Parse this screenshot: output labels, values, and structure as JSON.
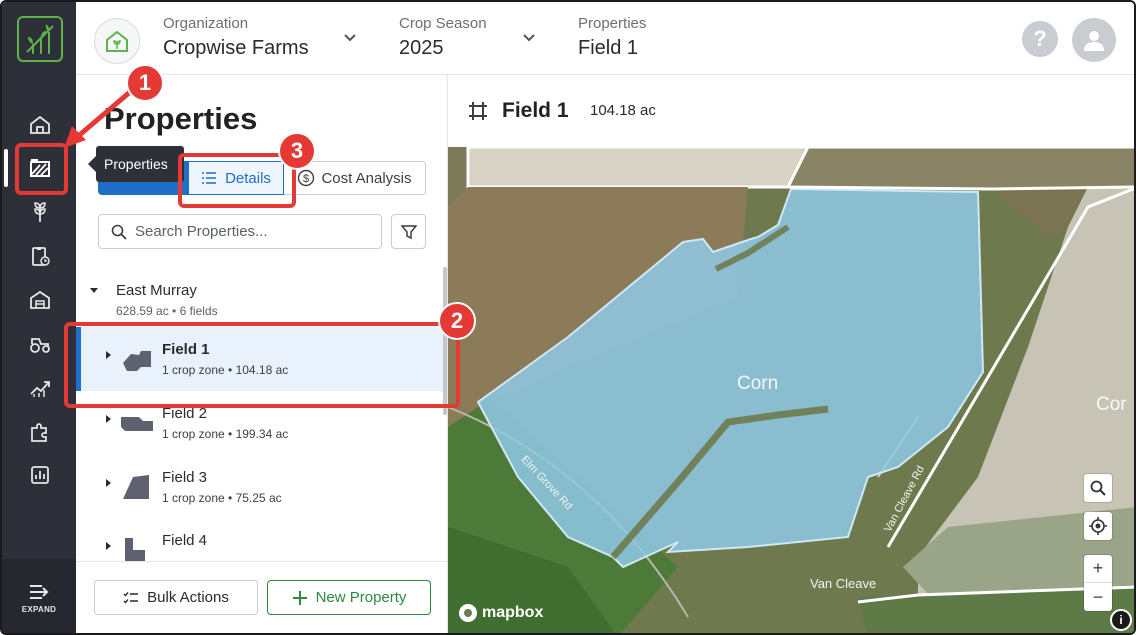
{
  "topbar": {
    "organization": {
      "label": "Organization",
      "value": "Cropwise Farms"
    },
    "crop_season": {
      "label": "Crop Season",
      "value": "2025"
    },
    "properties": {
      "label": "Properties",
      "value": "Field 1"
    },
    "help_label": "?"
  },
  "nav": {
    "items": [
      "home-icon",
      "properties-icon",
      "crop-icon",
      "plan-icon",
      "storage-icon",
      "equipment-icon",
      "analytics-growth-icon",
      "integrations-icon",
      "reports-icon"
    ],
    "expand_label": "EXPAND",
    "tooltip": "Properties"
  },
  "panel": {
    "title": "Properties",
    "tabs": {
      "details": "Details",
      "cost_analysis": "Cost Analysis"
    },
    "search_placeholder": "Search Properties...",
    "group": {
      "name": "East Murray",
      "meta": "628.59 ac • 6 fields"
    },
    "fields": [
      {
        "name": "Field 1",
        "meta": "1 crop zone • 104.18 ac"
      },
      {
        "name": "Field 2",
        "meta": "1 crop zone • 199.34 ac"
      },
      {
        "name": "Field 3",
        "meta": "1 crop zone • 75.25 ac"
      },
      {
        "name": "Field 4",
        "meta": ""
      }
    ],
    "footer": {
      "bulk_actions": "Bulk Actions",
      "new_property": "New Property"
    }
  },
  "map": {
    "title": "Field 1",
    "area": "104.18 ac",
    "crop_label": "Corn",
    "neighbor_label": "Cor",
    "road_labels": [
      "Elm Grove Rd",
      "Van Cleave Rd",
      "Van Cleave"
    ],
    "attribution": "mapbox",
    "info_label": "i",
    "zoom_in": "+",
    "zoom_out": "−"
  },
  "annotations": {
    "badge1": "1",
    "badge2": "2",
    "badge3": "3"
  },
  "colors": {
    "accent": "#1f6ec7",
    "success": "#2b8a3e",
    "annotation": "#e53935",
    "nav_bg": "#2d3038",
    "field_fill": "#8fc9e6"
  }
}
